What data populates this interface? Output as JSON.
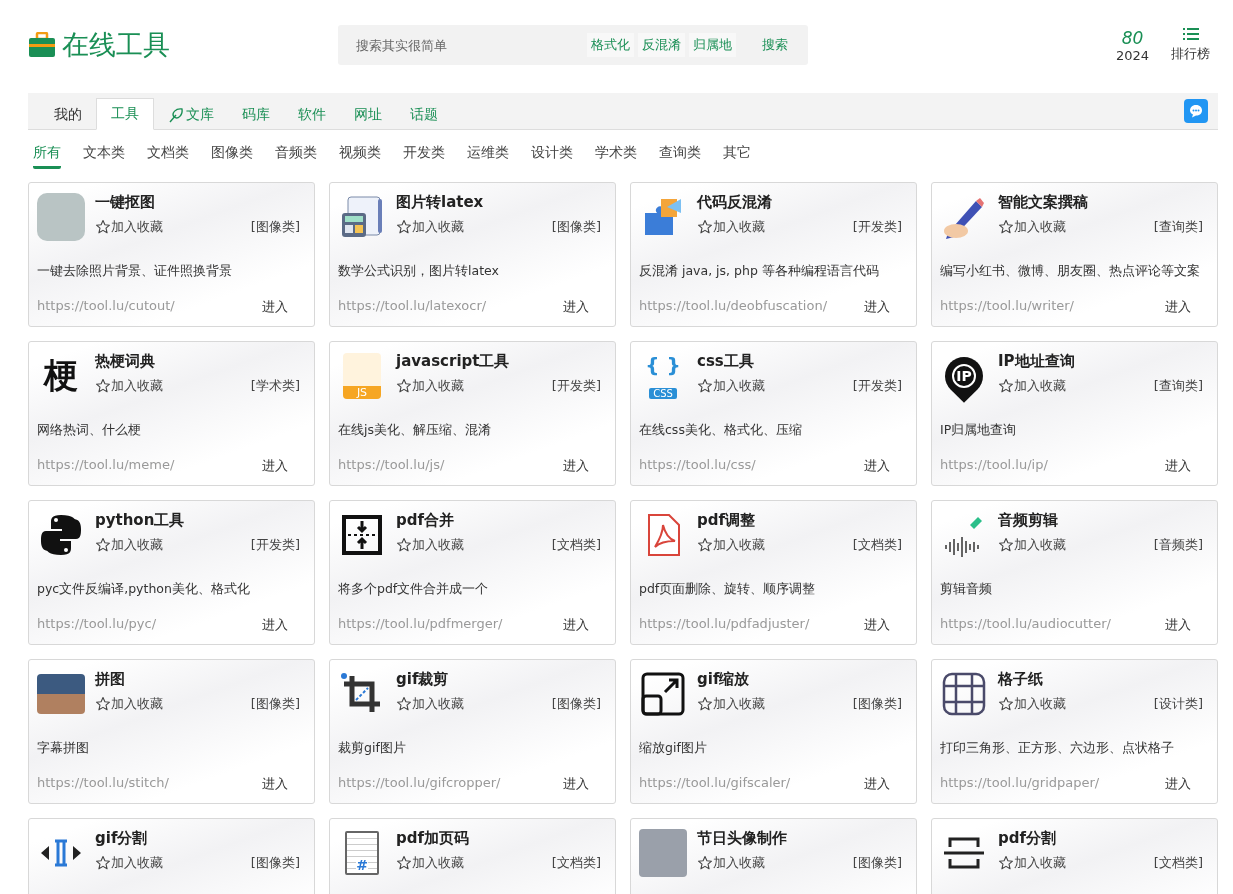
{
  "header": {
    "logo": "在线工具",
    "search": {
      "placeholder": "搜索其实很简单",
      "tags": [
        "格式化",
        "反混淆",
        "归属地"
      ],
      "button": "搜索"
    },
    "counter": {
      "value": "80",
      "year": "2024"
    },
    "ranking": "排行榜"
  },
  "nav_tabs": [
    {
      "label": "我的",
      "selected": false,
      "kind": "text"
    },
    {
      "label": "工具",
      "selected": true,
      "kind": "text"
    },
    {
      "label": "文库",
      "selected": false,
      "kind": "leaf"
    },
    {
      "label": "码库",
      "selected": false,
      "kind": "text"
    },
    {
      "label": "软件",
      "selected": false,
      "kind": "text"
    },
    {
      "label": "网址",
      "selected": false,
      "kind": "text"
    },
    {
      "label": "话题",
      "selected": false,
      "kind": "text"
    }
  ],
  "categories": [
    {
      "label": "所有",
      "selected": true
    },
    {
      "label": "文本类",
      "selected": false
    },
    {
      "label": "文档类",
      "selected": false
    },
    {
      "label": "图像类",
      "selected": false
    },
    {
      "label": "音频类",
      "selected": false
    },
    {
      "label": "视频类",
      "selected": false
    },
    {
      "label": "开发类",
      "selected": false
    },
    {
      "label": "运维类",
      "selected": false
    },
    {
      "label": "设计类",
      "selected": false
    },
    {
      "label": "学术类",
      "selected": false
    },
    {
      "label": "查询类",
      "selected": false
    },
    {
      "label": "其它",
      "selected": false
    }
  ],
  "tools": [
    {
      "title": "一键抠图",
      "kind": "photo",
      "favorite": "加入收藏",
      "category": "[图像类]",
      "description": "一键去除照片背景、证件照换背景",
      "url": "https://tool.lu/cutout/",
      "enter": "进入"
    },
    {
      "title": "图片转latex",
      "kind": "calculator",
      "favorite": "加入收藏",
      "category": "[图像类]",
      "description": "数学公式识别，图片转latex",
      "url": "https://tool.lu/latexocr/",
      "enter": "进入"
    },
    {
      "title": "代码反混淆",
      "kind": "puzzle",
      "favorite": "加入收藏",
      "category": "[开发类]",
      "description": "反混淆 java, js, php 等各种编程语言代码",
      "url": "https://tool.lu/deobfuscation/",
      "enter": "进入"
    },
    {
      "title": "智能文案撰稿",
      "kind": "pen",
      "favorite": "加入收藏",
      "category": "[查询类]",
      "description": "编写小红书、微博、朋友圈、热点评论等文案",
      "url": "https://tool.lu/writer/",
      "enter": "进入"
    },
    {
      "title": "热梗词典",
      "kind": "glyph",
      "icon_text": "梗",
      "favorite": "加入收藏",
      "category": "[学术类]",
      "description": "网络热词、什么梗",
      "url": "https://tool.lu/meme/",
      "enter": "进入"
    },
    {
      "title": "javascript工具",
      "kind": "file",
      "icon_text": "JS",
      "favorite": "加入收藏",
      "category": "[开发类]",
      "description": "在线js美化、解压缩、混淆",
      "url": "https://tool.lu/js/",
      "enter": "进入"
    },
    {
      "title": "css工具",
      "kind": "braces",
      "icon_glyph": "{ }",
      "icon_text": "CSS",
      "favorite": "加入收藏",
      "category": "[开发类]",
      "description": "在线css美化、格式化、压缩",
      "url": "https://tool.lu/css/",
      "enter": "进入"
    },
    {
      "title": "IP地址查询",
      "kind": "pin",
      "icon_text": "IP",
      "favorite": "加入收藏",
      "category": "[查询类]",
      "description": "IP归属地查询",
      "url": "https://tool.lu/ip/",
      "enter": "进入"
    },
    {
      "title": "python工具",
      "kind": "python",
      "favorite": "加入收藏",
      "category": "[开发类]",
      "description": "pyc文件反编译,python美化、格式化",
      "url": "https://tool.lu/pyc/",
      "enter": "进入"
    },
    {
      "title": "pdf合并",
      "kind": "merge",
      "favorite": "加入收藏",
      "category": "[文档类]",
      "description": "将多个pdf文件合并成一个",
      "url": "https://tool.lu/pdfmerger/",
      "enter": "进入"
    },
    {
      "title": "pdf调整",
      "kind": "pdf",
      "favorite": "加入收藏",
      "category": "[文档类]",
      "description": "pdf页面删除、旋转、顺序调整",
      "url": "https://tool.lu/pdfadjuster/",
      "enter": "进入"
    },
    {
      "title": "音频剪辑",
      "kind": "audio",
      "favorite": "加入收藏",
      "category": "[音频类]",
      "description": "剪辑音频",
      "url": "https://tool.lu/audiocutter/",
      "enter": "进入"
    },
    {
      "title": "拼图",
      "kind": "landscape",
      "favorite": "加入收藏",
      "category": "[图像类]",
      "description": "字幕拼图",
      "url": "https://tool.lu/stitch/",
      "enter": "进入"
    },
    {
      "title": "gif裁剪",
      "kind": "crop",
      "favorite": "加入收藏",
      "category": "[图像类]",
      "description": "裁剪gif图片",
      "url": "https://tool.lu/gifcropper/",
      "enter": "进入"
    },
    {
      "title": "gif缩放",
      "kind": "scale",
      "favorite": "加入收藏",
      "category": "[图像类]",
      "description": "缩放gif图片",
      "url": "https://tool.lu/gifscaler/",
      "enter": "进入"
    },
    {
      "title": "格子纸",
      "kind": "grid",
      "favorite": "加入收藏",
      "category": "[设计类]",
      "description": "打印三角形、正方形、六边形、点状格子",
      "url": "https://tool.lu/gridpaper/",
      "enter": "进入"
    },
    {
      "title": "gif分割",
      "kind": "split",
      "favorite": "加入收藏",
      "category": "[图像类]"
    },
    {
      "title": "pdf加页码",
      "kind": "doc",
      "icon_text": "#",
      "favorite": "加入收藏",
      "category": "[文档类]"
    },
    {
      "title": "节日头像制作",
      "kind": "avatar",
      "favorite": "加入收藏",
      "category": "[图像类]"
    },
    {
      "title": "pdf分割",
      "kind": "cut",
      "favorite": "加入收藏",
      "category": "[文档类]"
    }
  ]
}
